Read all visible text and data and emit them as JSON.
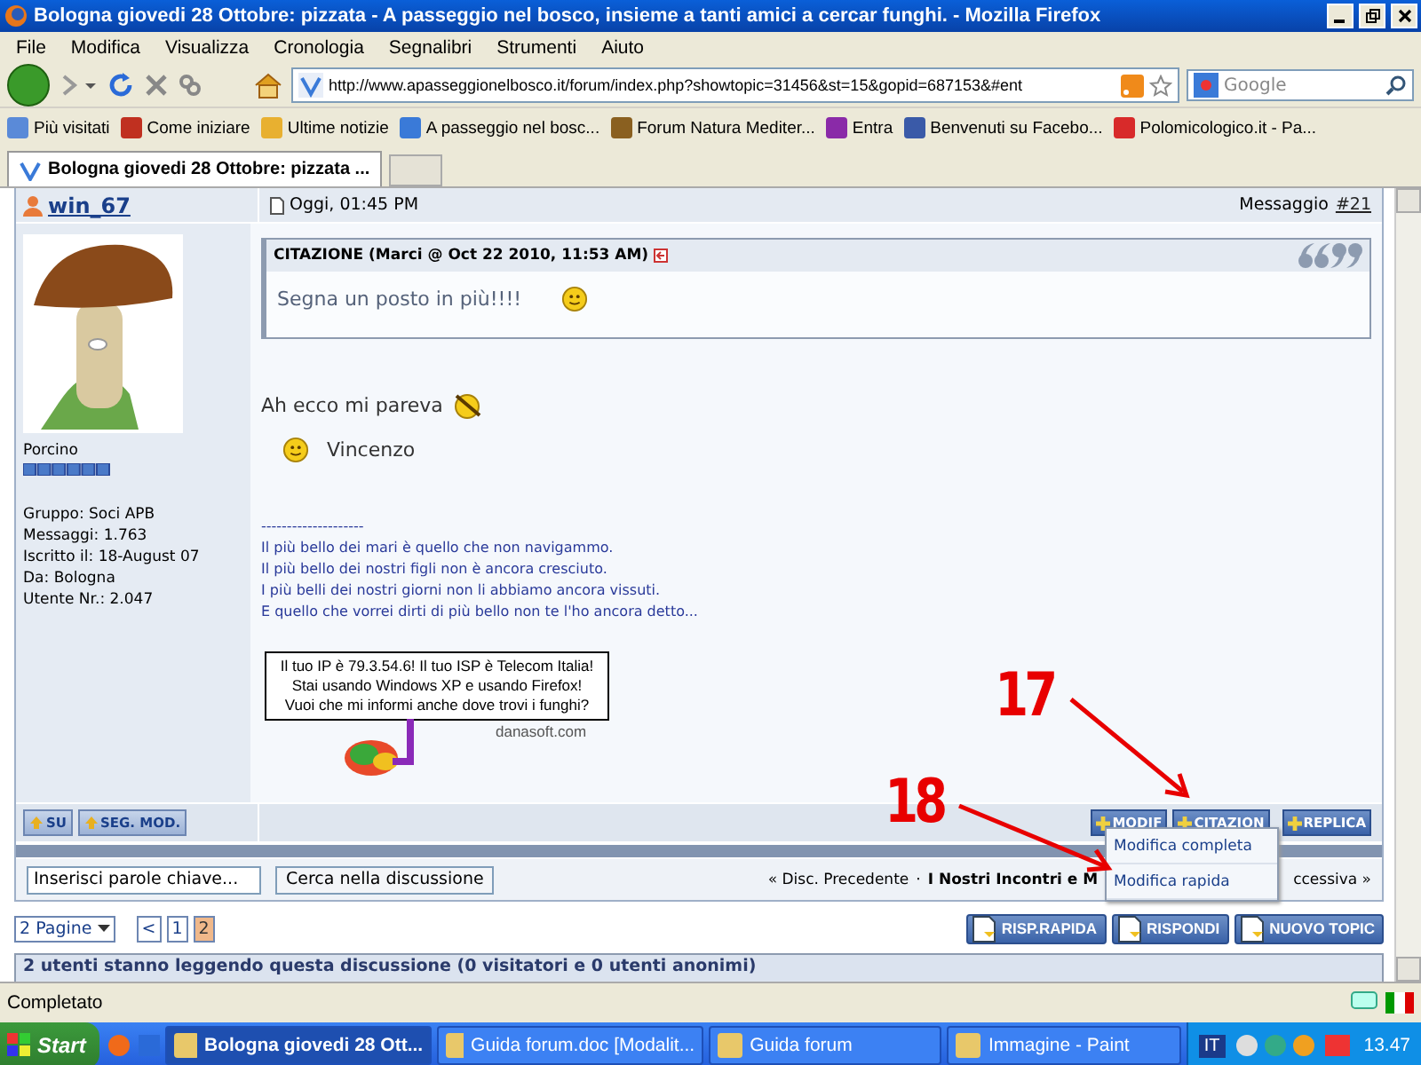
{
  "window": {
    "title": "Bologna giovedi 28 Ottobre: pizzata - A passeggio nel bosco, insieme a tanti amici a cercar funghi. - Mozilla Firefox"
  },
  "menu": [
    "File",
    "Modifica",
    "Visualizza",
    "Cronologia",
    "Segnalibri",
    "Strumenti",
    "Aiuto"
  ],
  "toolbar": {
    "url": "http://www.apasseggionelbosco.it/forum/index.php?showtopic=31456&st=15&gopid=687153&#ent",
    "search_placeholder": "Google"
  },
  "bookmarks": [
    "Più visitati",
    "Come iniziare",
    "Ultime notizie",
    "A passeggio nel bosc...",
    "Forum Natura Mediter...",
    "Entra",
    "Benvenuti su Facebo...",
    "Polomicologico.it - Pa..."
  ],
  "tabs": [
    {
      "label": "Bologna giovedi 28 Ottobre: pizzata ...",
      "selected": true
    }
  ],
  "post": {
    "author": "win_67",
    "date": "Oggi, 01:45 PM",
    "message_label": "Messaggio",
    "message_link": "#21",
    "user": {
      "rank": "Porcino",
      "info": [
        "Gruppo: Soci APB",
        "Messaggi: 1.763",
        "Iscritto il: 18-August 07",
        "Da: Bologna",
        "Utente Nr.: 2.047"
      ]
    },
    "quote": {
      "header": "CITAZIONE (Marci @ Oct 22 2010, 11:53 AM)",
      "text": "Segna un posto in più!!!!"
    },
    "body": [
      "Ah ecco mi pareva",
      "Vincenzo"
    ],
    "signature": [
      "--------------------",
      "Il più bello dei mari è quello che non navigammo.",
      "Il più bello dei nostri figli non è ancora cresciuto.",
      "I più belli dei nostri giorni non li abbiamo ancora vissuti.",
      "E quello che vorrei dirti di più bello non te l'ho ancora detto..."
    ],
    "banner": {
      "lines": [
        "Il tuo IP è 79.3.54.6! Il tuo ISP è Telecom Italia!",
        "Stai usando Windows XP e usando Firefox!",
        "Vuoi che mi informi anche dove trovi i funghi?"
      ],
      "credit": "danasoft.com"
    },
    "left_buttons": [
      "SU",
      "SEG. MOD."
    ],
    "right_buttons": [
      "MODIF",
      "CITAZION",
      "REPLICA"
    ],
    "edit_menu": [
      "Modifica completa",
      "Modifica rapida"
    ]
  },
  "search": {
    "value": "Inserisci parole chiave...",
    "button": "Cerca nella discussione"
  },
  "topic_nav": {
    "previous": "« Disc. Precedente",
    "separator": "·",
    "topic": "I Nostri Incontri e M",
    "next": "ccessiva »"
  },
  "pagination": {
    "pages_label": "2 Pagine",
    "prev": "<",
    "pages": [
      {
        "label": "1",
        "selected": false
      },
      {
        "label": "2",
        "selected": true
      }
    ]
  },
  "actions": [
    "RISP.RAPIDA",
    "RISPONDI",
    "NUOVO TOPIC"
  ],
  "readers": "2 utenti stanno leggendo questa discussione (0 visitatori e 0 utenti anonimi)",
  "annotations": [
    "17",
    "18"
  ],
  "status_bar": {
    "text": "Completato"
  },
  "taskbar": {
    "start": "Start",
    "items": [
      {
        "label": "Bologna giovedi 28 Ott...",
        "selected": true
      },
      {
        "label": "Guida forum.doc [Modalit...",
        "selected": false
      },
      {
        "label": "Guida forum",
        "selected": false
      },
      {
        "label": "Immagine - Paint",
        "selected": false
      }
    ],
    "language": "IT",
    "clock": "13.47"
  }
}
